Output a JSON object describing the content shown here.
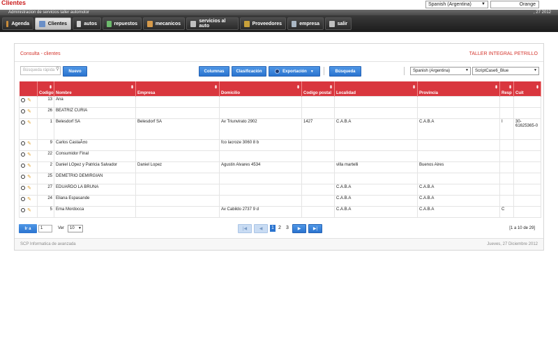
{
  "app": {
    "title": "Clientes",
    "subtitle": "Administracion de servicios taller automotor",
    "date_short": ", 27 2012",
    "language": "Spanish (Argentina)",
    "theme": "Orange"
  },
  "menu": [
    {
      "label": "Agenda",
      "icon": "calendar-icon",
      "color": "#c98c3a"
    },
    {
      "label": "Clientes",
      "icon": "user-icon",
      "color": "#6a8fc7",
      "active": true
    },
    {
      "label": "autos",
      "icon": "wrench-icon",
      "color": "#d0d0d0"
    },
    {
      "label": "repuestos",
      "icon": "gear-icon",
      "color": "#6cba6c"
    },
    {
      "label": "mecanicos",
      "icon": "mechanic-icon",
      "color": "#d69a4a"
    },
    {
      "label": "servicios al auto",
      "icon": "service-icon",
      "color": "#c0c0c0"
    },
    {
      "label": "Proveedores",
      "icon": "supplier-icon",
      "color": "#c9a13a"
    },
    {
      "label": "empresa",
      "icon": "building-icon",
      "color": "#aab7c4"
    },
    {
      "label": "salir",
      "icon": "exit-icon",
      "color": "#c0c0c0"
    }
  ],
  "panel": {
    "title": "Consulta - clientes",
    "company": "TALLER INTEGRAL PETRILLO"
  },
  "toolbar": {
    "search_placeholder": "Búsqueda rápida",
    "new": "Nuevo",
    "columns": "Columnas",
    "classification": "Clasificación",
    "export": "Exportación",
    "search": "Búsqueda",
    "language": "Spanish (Argentina)",
    "theme": "ScriptCase6_Blue"
  },
  "table": {
    "headers": [
      "Codigo",
      "Nombre",
      "Empresa",
      "Domicilio",
      "Codigo postal",
      "Localidad",
      "Provincia",
      "Resp",
      "Cuit"
    ],
    "rows": [
      [
        "13",
        "Ana",
        "",
        "",
        "",
        "",
        "",
        "",
        ""
      ],
      [
        "26",
        "BEATRIZ CURIA",
        "",
        "",
        "",
        "",
        "",
        "",
        ""
      ],
      [
        "1",
        "Belesdorf SA",
        "Belesdorf SA",
        "Av Triunvirato 2902",
        "1427",
        "C.A.B.A",
        "C.A.B.A",
        "I",
        "30-61625365-0"
      ],
      [
        "9",
        "Carlos CastaÃ±o",
        "",
        "fco lacroze 3060 8 b",
        "",
        "",
        "",
        "",
        ""
      ],
      [
        "22",
        "Consumidor Final",
        "",
        "",
        "",
        "",
        "",
        "",
        ""
      ],
      [
        "2",
        "Daniel LOpez y Patricia Salvador",
        "Daniel Lopez",
        "Agustin Alvares 4534",
        "",
        "villa martelli",
        "Buenos Aires",
        "",
        ""
      ],
      [
        "25",
        "DEMETRIO DEMIRGIAN",
        "",
        "",
        "",
        "",
        "",
        "",
        ""
      ],
      [
        "27",
        "EDUARDO LA BRUNA",
        "",
        "",
        "",
        "C.A.B.A",
        "C.A.B.A",
        "",
        ""
      ],
      [
        "24",
        "Eliana Espasande",
        "",
        "",
        "",
        "C.A.B.A",
        "C.A.B.A",
        "",
        ""
      ],
      [
        "5",
        "Ema Mordocca",
        "",
        "Av Cabildo 2737 9 d",
        "",
        "C.A.B.A",
        "C.A.B.A",
        "C",
        ""
      ]
    ]
  },
  "pager": {
    "goto": "Ir a",
    "page_value": "1",
    "view_label": "Ver",
    "per_page": "10",
    "pages": [
      "1",
      "2",
      "3"
    ],
    "current_page": "1",
    "count": "[1 a 10 de 29]"
  },
  "footer": {
    "left": "SCP Informatica de avanzada",
    "right": "Jueves, 27 Diciembre 2012"
  }
}
